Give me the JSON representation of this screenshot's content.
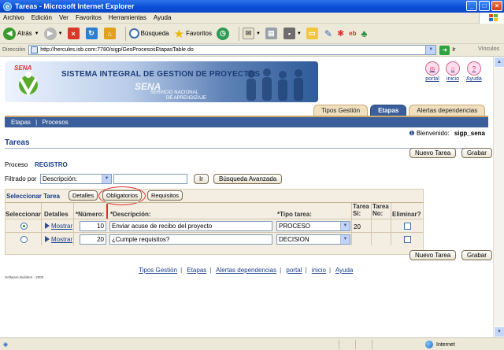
{
  "window": {
    "title": "Tareas - Microsoft Internet Explorer",
    "buttons": [
      "_",
      "□",
      "×"
    ]
  },
  "menu": [
    "Archivo",
    "Edición",
    "Ver",
    "Favoritos",
    "Herramientas",
    "Ayuda"
  ],
  "toolbar": {
    "back": "Atrás",
    "search": "Búsqueda",
    "favorites": "Favoritos"
  },
  "address": {
    "label": "Dirección",
    "url": "http://hercules.isb.com:7780/sigp/GesProcesosEtapasTable.do",
    "go": "Ir",
    "links": "Vínculos"
  },
  "banner": {
    "logo": "SENA",
    "title": "SISTEMA INTEGRAL DE GESTION DE PROYECTOS",
    "watermark": "SENA",
    "sub1": "SERVICIO NACIONAL",
    "sub2": "DE APRENDIZAJE"
  },
  "top_links": [
    "portal",
    "inicio",
    "Ayuda"
  ],
  "tabs": [
    {
      "label": "Tipos Gestión",
      "active": false
    },
    {
      "label": "Etapas",
      "active": true
    },
    {
      "label": "Alertas dependencias",
      "active": false
    }
  ],
  "subnav": {
    "item1": "Etapas",
    "sep": "|",
    "item2": "Procesos"
  },
  "welcome": {
    "label": "Bienvenido:",
    "user": "sigp_sena"
  },
  "page": {
    "title": "Tareas",
    "new_task": "Nuevo Tarea",
    "save": "Grabar",
    "process_label": "Proceso",
    "process_value": "REGISTRO",
    "filter_label": "Filtrado por",
    "filter_value": "Descripción:",
    "go": "Ir",
    "advanced": "Búsqueda Avanzada"
  },
  "grid": {
    "select_tab_label": "Seleccionar Tarea",
    "subtabs": [
      "Detalles",
      "Obligatorios",
      "Requisitos"
    ],
    "headers": {
      "select": "Seleccionar",
      "details": "Detalles",
      "number": "*Número:",
      "description": "*Descripción:",
      "task_type": "*Tipo tarea:",
      "task_yes": "Tarea Si:",
      "task_no": "Tarea No:",
      "delete": "Eliminar?"
    },
    "rows": [
      {
        "selected": true,
        "details": "Mostrar",
        "number": "10",
        "description": "Enviar acuse de recibo del proyecto",
        "type": "PROCESO",
        "yes": "20",
        "no": ""
      },
      {
        "selected": false,
        "details": "Mostrar",
        "number": "20",
        "description": "¿Cumple requisitos?",
        "type": "DECISION",
        "yes": "",
        "no": ""
      }
    ]
  },
  "footer": {
    "links": [
      "Tipos Gestión",
      "Etapas",
      "Alertas dependencias",
      "portal",
      "inicio",
      "Ayuda"
    ],
    "sep": "|",
    "credit": "Software Builders - 2000"
  },
  "status": {
    "zone": "Internet"
  },
  "colors": {
    "accent": "#3a5f9a",
    "link": "#1a3e8a",
    "highlight": "#e03030"
  }
}
